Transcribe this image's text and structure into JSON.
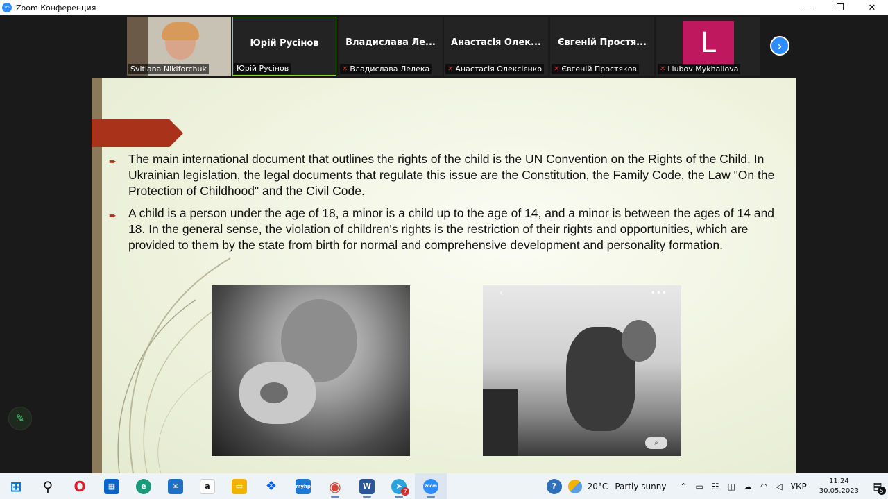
{
  "window": {
    "title": "Zoom Конференция",
    "minimize": "—",
    "maximize": "❐",
    "close": "✕"
  },
  "participants": [
    {
      "label": "Svitlana Nikiforchuk",
      "tile_name": "",
      "muted": false,
      "video": true
    },
    {
      "label": "Юрій Русінов",
      "tile_name": "Юрій Русінов",
      "muted": false,
      "active": true
    },
    {
      "label": "Владислава Лелека",
      "tile_name": "Владислава  Ле...",
      "muted": true
    },
    {
      "label": "Анастасія Олексієнко",
      "tile_name": "Анастасія  Олек...",
      "muted": true
    },
    {
      "label": "Євгеній Простяков",
      "tile_name": "Євгеній  Простя...",
      "muted": true
    },
    {
      "label": "Liubov Mykhailova",
      "tile_name": "",
      "muted": true,
      "avatar_letter": "L"
    }
  ],
  "slide": {
    "bullets": [
      "The main international document that outlines the rights of the child is the UN Convention on the Rights of the Child. In Ukrainian legislation, the legal documents that regulate this issue are the Constitution, the Family Code, the Law \"On the Protection of Childhood\" and the Civil Code.",
      "A child is a person under the age of 18, a minor is a child up to the age of 14, and a minor is between the ages of 14 and 18. In the general sense, the violation of children's rights is the restriction of their rights and opportunities, which are provided to them by the state from birth for normal and comprehensive development and personality formation."
    ],
    "photo2_back": "‹",
    "photo2_dots": "•••",
    "photo2_lens": "⌕"
  },
  "taskbar": {
    "apps": [
      {
        "name": "windows-start",
        "glyph": "⊞",
        "color": "#0078d4"
      },
      {
        "name": "search",
        "glyph": "⚲",
        "color": "#111111"
      },
      {
        "name": "opera",
        "glyph": "O",
        "color": "#e01b2c"
      },
      {
        "name": "microsoft-store",
        "glyph": "▦",
        "color": "#0a64c8"
      },
      {
        "name": "edge",
        "glyph": "e",
        "color": "#1a9a7a"
      },
      {
        "name": "mail",
        "glyph": "✉",
        "color": "#1e6fc8"
      },
      {
        "name": "amazon",
        "glyph": "a",
        "color": "#ffffff"
      },
      {
        "name": "file-explorer",
        "glyph": "▭",
        "color": "#f0b400"
      },
      {
        "name": "dropbox",
        "glyph": "❖",
        "color": "#0061fe"
      },
      {
        "name": "myhp",
        "glyph": "myhp",
        "color": "#1e78d8"
      },
      {
        "name": "chrome",
        "glyph": "◉",
        "color": "#db4437"
      },
      {
        "name": "word",
        "glyph": "W",
        "color": "#2b579a"
      },
      {
        "name": "telegram",
        "glyph": "➤",
        "color": "#2aa3dd",
        "badge": "7"
      },
      {
        "name": "zoom",
        "glyph": "zoom",
        "color": "#2d8cff"
      }
    ],
    "help": "?",
    "weather_temp": "20°C",
    "weather_text": "Partly sunny",
    "language": "УКР",
    "time": "11:24",
    "date": "30.05.2023",
    "notifications": "5"
  }
}
